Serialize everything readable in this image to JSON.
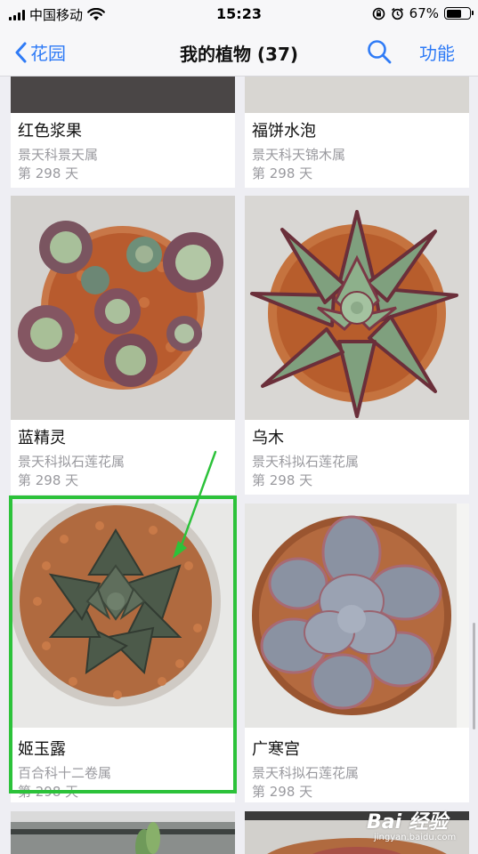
{
  "status_bar": {
    "carrier": "中国移动",
    "time": "15:23",
    "battery_percent": "67%",
    "battery_level": 0.67,
    "icons": [
      "signal-icon",
      "wifi-icon",
      "orientation-lock-icon",
      "alarm-icon",
      "battery-icon"
    ]
  },
  "nav": {
    "back_label": "花园",
    "title": "我的植物 (37)",
    "action_label": "功能",
    "icons": [
      "chevron-left-icon",
      "search-icon"
    ]
  },
  "plants": [
    {
      "name": "红色浆果",
      "family": "景天科景天属",
      "days": "第 298 天"
    },
    {
      "name": "福饼水泡",
      "family": "景天科天锦木属",
      "days": "第 298 天"
    },
    {
      "name": "蓝精灵",
      "family": "景天科拟石莲花属",
      "days": "第 298 天"
    },
    {
      "name": "乌木",
      "family": "景天科拟石莲花属",
      "days": "第 298 天"
    },
    {
      "name": "姬玉露",
      "family": "百合科十二卷属",
      "days": "第 298 天"
    },
    {
      "name": "广寒宫",
      "family": "景天科拟石莲花属",
      "days": "第 298 天"
    }
  ],
  "watermark": {
    "brand": "Bai 经验",
    "url": "jingyan.baidu.com"
  },
  "colors": {
    "accent": "#2f7bf6",
    "highlight": "#2cc23a",
    "subtext": "#9a9a9f",
    "background": "#eeeef3"
  }
}
